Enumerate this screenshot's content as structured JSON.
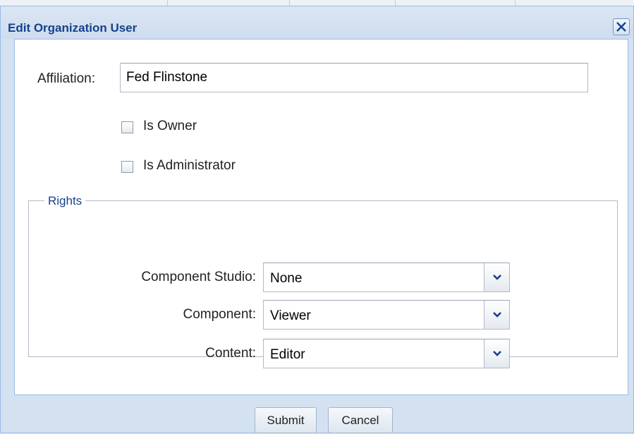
{
  "dialog": {
    "title": "Edit Organization User"
  },
  "form": {
    "affiliation_label": "Affiliation:",
    "affiliation_value": "Fed Flinstone",
    "is_owner_label": "Is Owner",
    "is_owner_checked": false,
    "is_admin_label": "Is Administrator",
    "is_admin_checked": false
  },
  "rights": {
    "legend": "Rights",
    "component_studio_label": "Component Studio:",
    "component_studio_value": "None",
    "component_label": "Component:",
    "component_value": "Viewer",
    "content_label": "Content:",
    "content_value": "Editor"
  },
  "buttons": {
    "submit": "Submit",
    "cancel": "Cancel"
  },
  "icons": {
    "close": "close-icon",
    "dropdown": "chevron-down-icon"
  },
  "colors": {
    "title_text": "#15428b",
    "window_frame": "#d3e1f1",
    "border": "#99bbe8"
  }
}
